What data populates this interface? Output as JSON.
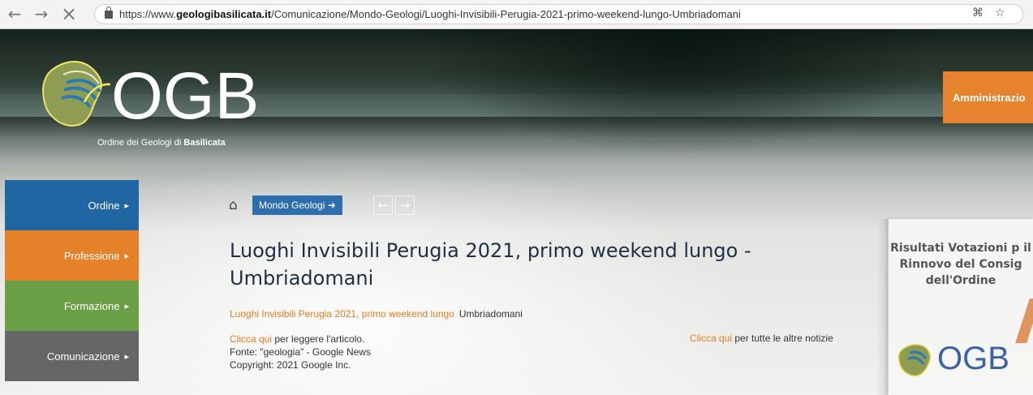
{
  "browser": {
    "url_prefix": "https://www.",
    "url_domain": "geologibasilicata.it",
    "url_path": "/Comunicazione/Mondo-Geologi/Luoghi-Invisibili-Perugia-2021-primo-weekend-lungo-Umbriadomani"
  },
  "brand": {
    "logo_text": "OGB",
    "subtitle": "Ordine dei Geologi di",
    "subtitle_bold": "Basilicata"
  },
  "header": {
    "admin_label": "Amministrazio"
  },
  "sidebar": {
    "items": [
      {
        "label": "Ordine",
        "color": "#1f66a3"
      },
      {
        "label": "Professione",
        "color": "#e58128"
      },
      {
        "label": "Formazione",
        "color": "#6b9f46"
      },
      {
        "label": "Comunicazione",
        "color": "#666666"
      }
    ]
  },
  "content": {
    "breadcrumb_label": "Mondo Geologi",
    "title": "Luoghi Invisibili Perugia 2021, primo weekend lungo - Umbriadomani",
    "source_link": "Luoghi Invisibili Perugia 2021, primo weekend lungo",
    "source_name": "Umbriadomani",
    "cta_link": "Clicca qui",
    "cta_text": "per leggere l'articolo.",
    "source_line": "Fonte: \"geologia\" - Google News",
    "copyright": "Copyright: 2021 Google Inc.",
    "all_news_link": "Clicca qui",
    "all_news_text": "per tutte le altre notizie"
  },
  "right_panel": {
    "heading": "Risultati Votazioni p il Rinnovo del Consig dell'Ordine",
    "logo_text": "OGB"
  }
}
